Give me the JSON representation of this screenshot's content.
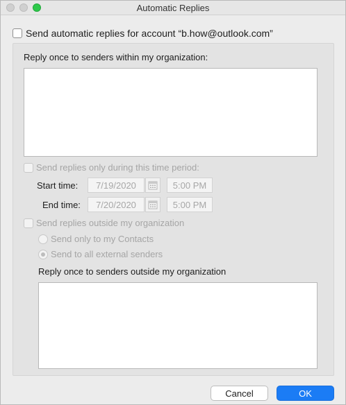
{
  "window": {
    "title": "Automatic Replies"
  },
  "main_checkbox": {
    "label": "Send automatic replies for account “b.how@outlook.com”",
    "checked": false
  },
  "internal": {
    "label": "Reply once to senders within my organization:",
    "message": ""
  },
  "time_period": {
    "label": "Send replies only during this time period:",
    "checked": false,
    "start_label": "Start time:",
    "start_date": "7/19/2020",
    "start_time": "5:00 PM",
    "end_label": "End time:",
    "end_date": "7/20/2020",
    "end_time": "5:00 PM"
  },
  "outside": {
    "label": "Send replies outside my organization",
    "checked": false,
    "option_contacts": "Send only to my Contacts",
    "option_all": "Send to all external senders",
    "selected": "Send to all external senders",
    "reply_label": "Reply once to senders outside my organization",
    "message": ""
  },
  "buttons": {
    "cancel": "Cancel",
    "ok": "OK"
  },
  "colors": {
    "accent": "#1b7cf5",
    "zoom_button": "#2ec94b"
  },
  "icons": {
    "calendar": "calendar-icon"
  }
}
